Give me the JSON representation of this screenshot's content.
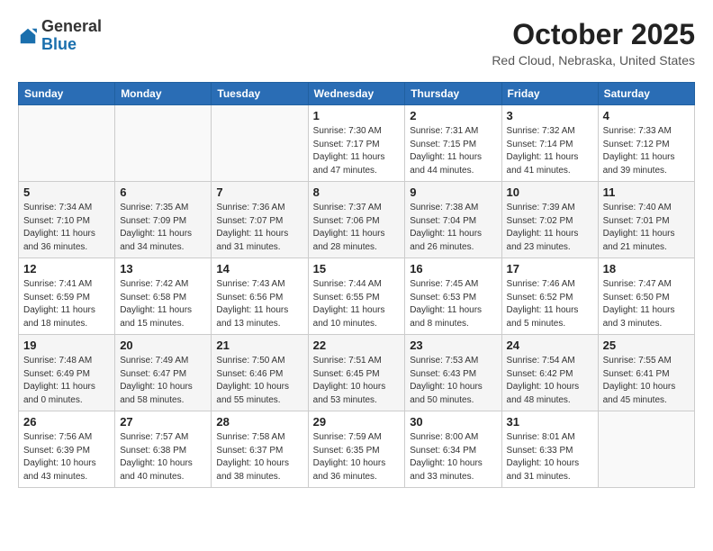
{
  "header": {
    "logo_general": "General",
    "logo_blue": "Blue",
    "title": "October 2025",
    "location": "Red Cloud, Nebraska, United States"
  },
  "weekdays": [
    "Sunday",
    "Monday",
    "Tuesday",
    "Wednesday",
    "Thursday",
    "Friday",
    "Saturday"
  ],
  "weeks": [
    [
      {
        "day": "",
        "info": ""
      },
      {
        "day": "",
        "info": ""
      },
      {
        "day": "",
        "info": ""
      },
      {
        "day": "1",
        "info": "Sunrise: 7:30 AM\nSunset: 7:17 PM\nDaylight: 11 hours\nand 47 minutes."
      },
      {
        "day": "2",
        "info": "Sunrise: 7:31 AM\nSunset: 7:15 PM\nDaylight: 11 hours\nand 44 minutes."
      },
      {
        "day": "3",
        "info": "Sunrise: 7:32 AM\nSunset: 7:14 PM\nDaylight: 11 hours\nand 41 minutes."
      },
      {
        "day": "4",
        "info": "Sunrise: 7:33 AM\nSunset: 7:12 PM\nDaylight: 11 hours\nand 39 minutes."
      }
    ],
    [
      {
        "day": "5",
        "info": "Sunrise: 7:34 AM\nSunset: 7:10 PM\nDaylight: 11 hours\nand 36 minutes."
      },
      {
        "day": "6",
        "info": "Sunrise: 7:35 AM\nSunset: 7:09 PM\nDaylight: 11 hours\nand 34 minutes."
      },
      {
        "day": "7",
        "info": "Sunrise: 7:36 AM\nSunset: 7:07 PM\nDaylight: 11 hours\nand 31 minutes."
      },
      {
        "day": "8",
        "info": "Sunrise: 7:37 AM\nSunset: 7:06 PM\nDaylight: 11 hours\nand 28 minutes."
      },
      {
        "day": "9",
        "info": "Sunrise: 7:38 AM\nSunset: 7:04 PM\nDaylight: 11 hours\nand 26 minutes."
      },
      {
        "day": "10",
        "info": "Sunrise: 7:39 AM\nSunset: 7:02 PM\nDaylight: 11 hours\nand 23 minutes."
      },
      {
        "day": "11",
        "info": "Sunrise: 7:40 AM\nSunset: 7:01 PM\nDaylight: 11 hours\nand 21 minutes."
      }
    ],
    [
      {
        "day": "12",
        "info": "Sunrise: 7:41 AM\nSunset: 6:59 PM\nDaylight: 11 hours\nand 18 minutes."
      },
      {
        "day": "13",
        "info": "Sunrise: 7:42 AM\nSunset: 6:58 PM\nDaylight: 11 hours\nand 15 minutes."
      },
      {
        "day": "14",
        "info": "Sunrise: 7:43 AM\nSunset: 6:56 PM\nDaylight: 11 hours\nand 13 minutes."
      },
      {
        "day": "15",
        "info": "Sunrise: 7:44 AM\nSunset: 6:55 PM\nDaylight: 11 hours\nand 10 minutes."
      },
      {
        "day": "16",
        "info": "Sunrise: 7:45 AM\nSunset: 6:53 PM\nDaylight: 11 hours\nand 8 minutes."
      },
      {
        "day": "17",
        "info": "Sunrise: 7:46 AM\nSunset: 6:52 PM\nDaylight: 11 hours\nand 5 minutes."
      },
      {
        "day": "18",
        "info": "Sunrise: 7:47 AM\nSunset: 6:50 PM\nDaylight: 11 hours\nand 3 minutes."
      }
    ],
    [
      {
        "day": "19",
        "info": "Sunrise: 7:48 AM\nSunset: 6:49 PM\nDaylight: 11 hours\nand 0 minutes."
      },
      {
        "day": "20",
        "info": "Sunrise: 7:49 AM\nSunset: 6:47 PM\nDaylight: 10 hours\nand 58 minutes."
      },
      {
        "day": "21",
        "info": "Sunrise: 7:50 AM\nSunset: 6:46 PM\nDaylight: 10 hours\nand 55 minutes."
      },
      {
        "day": "22",
        "info": "Sunrise: 7:51 AM\nSunset: 6:45 PM\nDaylight: 10 hours\nand 53 minutes."
      },
      {
        "day": "23",
        "info": "Sunrise: 7:53 AM\nSunset: 6:43 PM\nDaylight: 10 hours\nand 50 minutes."
      },
      {
        "day": "24",
        "info": "Sunrise: 7:54 AM\nSunset: 6:42 PM\nDaylight: 10 hours\nand 48 minutes."
      },
      {
        "day": "25",
        "info": "Sunrise: 7:55 AM\nSunset: 6:41 PM\nDaylight: 10 hours\nand 45 minutes."
      }
    ],
    [
      {
        "day": "26",
        "info": "Sunrise: 7:56 AM\nSunset: 6:39 PM\nDaylight: 10 hours\nand 43 minutes."
      },
      {
        "day": "27",
        "info": "Sunrise: 7:57 AM\nSunset: 6:38 PM\nDaylight: 10 hours\nand 40 minutes."
      },
      {
        "day": "28",
        "info": "Sunrise: 7:58 AM\nSunset: 6:37 PM\nDaylight: 10 hours\nand 38 minutes."
      },
      {
        "day": "29",
        "info": "Sunrise: 7:59 AM\nSunset: 6:35 PM\nDaylight: 10 hours\nand 36 minutes."
      },
      {
        "day": "30",
        "info": "Sunrise: 8:00 AM\nSunset: 6:34 PM\nDaylight: 10 hours\nand 33 minutes."
      },
      {
        "day": "31",
        "info": "Sunrise: 8:01 AM\nSunset: 6:33 PM\nDaylight: 10 hours\nand 31 minutes."
      },
      {
        "day": "",
        "info": ""
      }
    ]
  ]
}
